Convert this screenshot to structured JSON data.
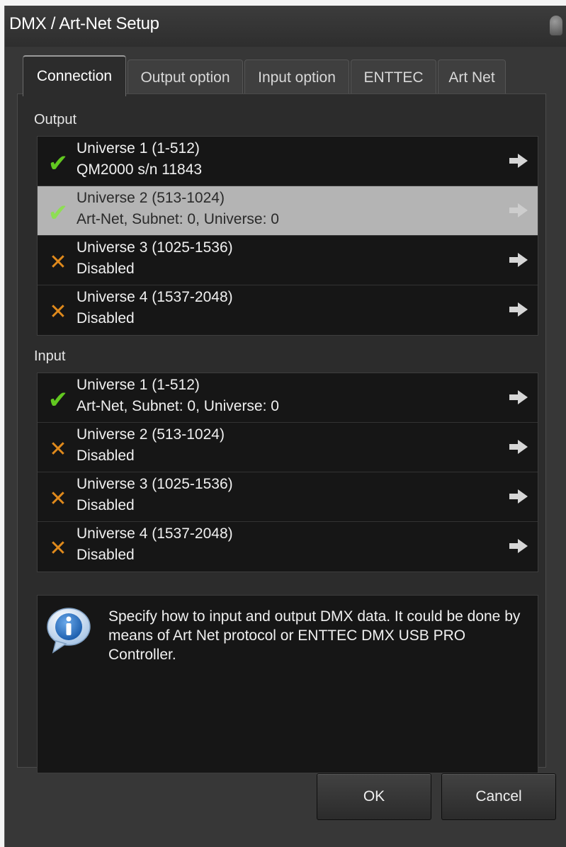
{
  "window": {
    "title": "DMX / Art-Net Setup"
  },
  "tabs": [
    {
      "label": "Connection",
      "active": true
    },
    {
      "label": "Output option"
    },
    {
      "label": "Input option"
    },
    {
      "label": "ENTTEC"
    },
    {
      "label": "Art Net"
    }
  ],
  "output": {
    "label": "Output",
    "rows": [
      {
        "title": "Universe 1 (1-512)",
        "sub": "QM2000 s/n 11843",
        "status": "enabled",
        "icon": "check-icon"
      },
      {
        "title": "Universe 2 (513-1024)",
        "sub": "Art-Net, Subnet: 0, Universe: 0",
        "status": "enabled",
        "icon": "check-icon",
        "selected": true
      },
      {
        "title": "Universe 3 (1025-1536)",
        "sub": "Disabled",
        "status": "disabled",
        "icon": "cross-icon"
      },
      {
        "title": "Universe 4 (1537-2048)",
        "sub": "Disabled",
        "status": "disabled",
        "icon": "cross-icon"
      }
    ]
  },
  "input": {
    "label": "Input",
    "rows": [
      {
        "title": "Universe 1 (1-512)",
        "sub": "Art-Net, Subnet: 0, Universe: 0",
        "status": "enabled",
        "icon": "check-icon"
      },
      {
        "title": "Universe 2 (513-1024)",
        "sub": "Disabled",
        "status": "disabled",
        "icon": "cross-icon"
      },
      {
        "title": "Universe 3 (1025-1536)",
        "sub": "Disabled",
        "status": "disabled",
        "icon": "cross-icon"
      },
      {
        "title": "Universe 4 (1537-2048)",
        "sub": "Disabled",
        "status": "disabled",
        "icon": "cross-icon"
      }
    ]
  },
  "info": {
    "icon": "info-icon",
    "text": "Specify how to input and output DMX data. It could be done by means of Art Net protocol or ENTTEC DMX USB PRO Controller."
  },
  "buttons": {
    "ok": "OK",
    "cancel": "Cancel"
  },
  "colors": {
    "window_bg": "#373737",
    "list_bg": "#161616",
    "selected_row": "#b4b4b4",
    "check_green": "#62c820",
    "cross_orange": "#e08a1c"
  }
}
